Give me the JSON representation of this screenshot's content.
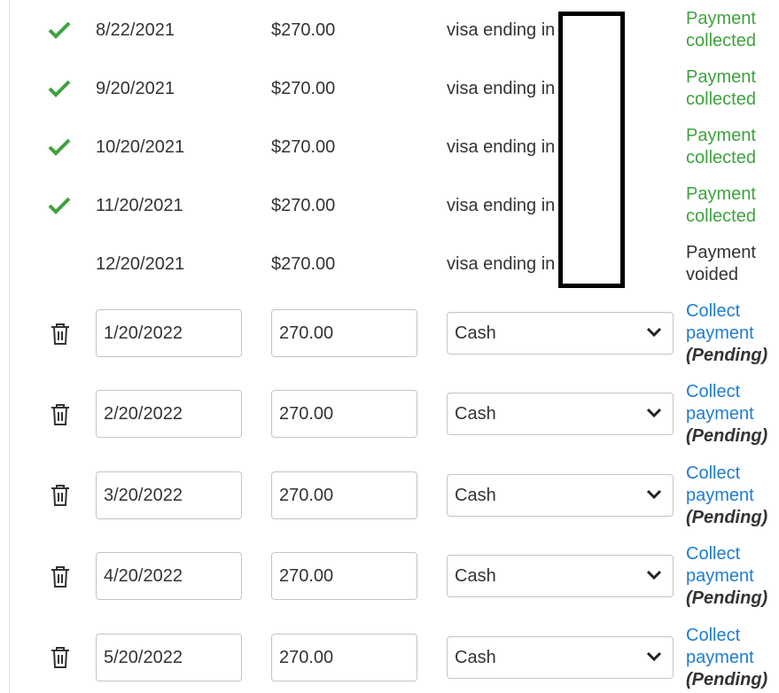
{
  "colors": {
    "collected": "#3ea23e",
    "link": "#1e7dce",
    "text": "#333333",
    "border": "#c4c4c4"
  },
  "past_payments": [
    {
      "date": "8/22/2021",
      "amount": "$270.00",
      "method": "visa ending in",
      "status_line1": "Payment",
      "status_line2": "collected",
      "icon": "check-icon"
    },
    {
      "date": "9/20/2021",
      "amount": "$270.00",
      "method": "visa ending in",
      "status_line1": "Payment",
      "status_line2": "collected",
      "icon": "check-icon"
    },
    {
      "date": "10/20/2021",
      "amount": "$270.00",
      "method": "visa ending in",
      "status_line1": "Payment",
      "status_line2": "collected",
      "icon": "check-icon"
    },
    {
      "date": "11/20/2021",
      "amount": "$270.00",
      "method": "visa ending in",
      "status_line1": "Payment",
      "status_line2": "collected",
      "icon": "check-icon"
    },
    {
      "date": "12/20/2021",
      "amount": "$270.00",
      "method": "visa ending in",
      "status_line1": "Payment",
      "status_line2": "voided",
      "icon": ""
    }
  ],
  "scheduled_payments": [
    {
      "date": "1/20/2022",
      "amount": "270.00",
      "method": "Cash",
      "link_line1": "Collect",
      "link_line2": "payment",
      "pending": "(Pending)",
      "icon": "trash-icon"
    },
    {
      "date": "2/20/2022",
      "amount": "270.00",
      "method": "Cash",
      "link_line1": "Collect",
      "link_line2": "payment",
      "pending": "(Pending)",
      "icon": "trash-icon"
    },
    {
      "date": "3/20/2022",
      "amount": "270.00",
      "method": "Cash",
      "link_line1": "Collect",
      "link_line2": "payment",
      "pending": "(Pending)",
      "icon": "trash-icon"
    },
    {
      "date": "4/20/2022",
      "amount": "270.00",
      "method": "Cash",
      "link_line1": "Collect",
      "link_line2": "payment",
      "pending": "(Pending)",
      "icon": "trash-icon"
    },
    {
      "date": "5/20/2022",
      "amount": "270.00",
      "method": "Cash",
      "link_line1": "Collect",
      "link_line2": "payment",
      "pending": "(Pending)",
      "icon": "trash-icon"
    }
  ]
}
